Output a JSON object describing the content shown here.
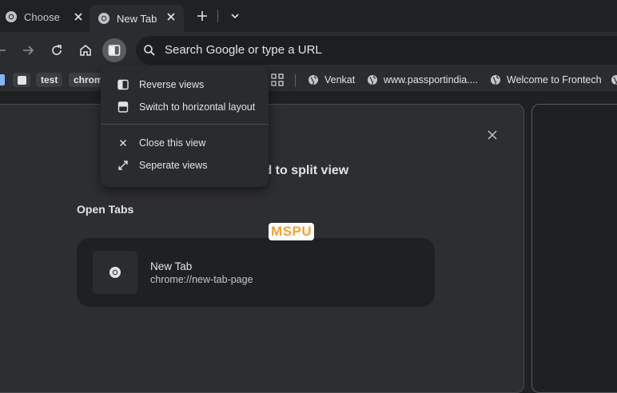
{
  "tabs": [
    {
      "title": "Choose a",
      "active": false
    },
    {
      "title": "New Tab",
      "active": true
    }
  ],
  "omnibox": {
    "placeholder": "Search Google or type a URL"
  },
  "bookmarks": {
    "chips": [
      "test",
      "chrom"
    ],
    "items": [
      "Venkat",
      "www.passportindia....",
      "Welcome to Frontech"
    ]
  },
  "split_view_menu": {
    "items": [
      "Reverse views",
      "Switch to horizontal layout",
      "Close this view",
      "Seperate views"
    ]
  },
  "panel": {
    "heading_partial": "ld to split view",
    "open_tabs_heading": "Open Tabs",
    "card": {
      "title": "New Tab",
      "url": "chrome://new-tab-page"
    }
  },
  "watermark": "MSPU",
  "colors": {
    "background": "#1f2022",
    "toolbar": "#2b2c2f",
    "menu": "#2a2b2e",
    "watermark": "#f0a23a"
  }
}
